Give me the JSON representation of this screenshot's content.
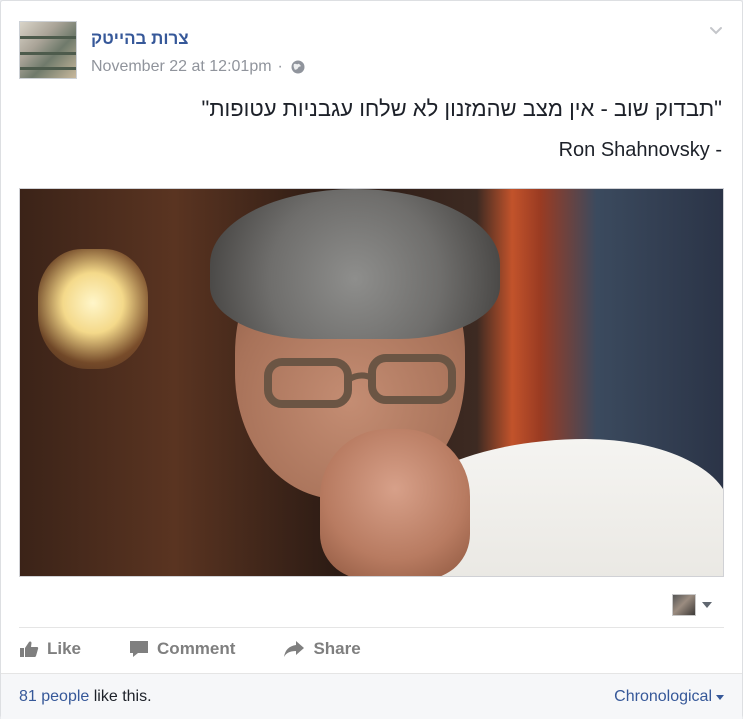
{
  "post": {
    "page_name": "צרות בהייטק",
    "timestamp": "November 22 at 12:01pm",
    "separator": "·",
    "privacy_icon": "globe-icon",
    "text_line1": "\"תבדוק שוב - אין מצב שהמזנון לא שלחו עגבניות עטופות\"",
    "text_line2": "Ron Shahnovsky -"
  },
  "actions": {
    "like_label": "Like",
    "comment_label": "Comment",
    "share_label": "Share"
  },
  "footer": {
    "likes_count_label": "81 people",
    "likes_suffix": " like this.",
    "sort_label": "Chronological"
  },
  "colors": {
    "link_blue": "#365899",
    "meta_gray": "#90949c",
    "action_gray": "#7f7f7f"
  }
}
